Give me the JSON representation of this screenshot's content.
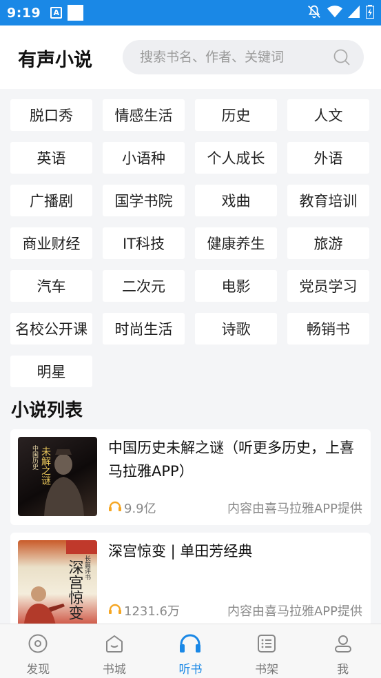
{
  "status_bar": {
    "time": "9:19",
    "a_glyph": "A"
  },
  "header": {
    "title": "有声小说",
    "search_placeholder": "搜索书名、作者、关键词"
  },
  "categories": [
    "脱口秀",
    "情感生活",
    "历史",
    "人文",
    "英语",
    "小语种",
    "个人成长",
    "外语",
    "广播剧",
    "国学书院",
    "戏曲",
    "教育培训",
    "商业财经",
    "IT科技",
    "健康养生",
    "旅游",
    "汽车",
    "二次元",
    "电影",
    "党员学习",
    "名校公开课",
    "时尚生活",
    "诗歌",
    "畅销书",
    "明星"
  ],
  "section_title": "小说列表",
  "novels": [
    {
      "title": "中国历史未解之谜（听更多历史，上喜马拉雅APP）",
      "plays": "9.9亿",
      "provider": "内容由喜马拉雅APP提供",
      "cover_text_a": "中国历史",
      "cover_text_b": "未解之谜"
    },
    {
      "title": "深宫惊变 | 单田芳经典",
      "plays": "1231.6万",
      "provider": "内容由喜马拉雅APP提供",
      "cover_text_a": "深宫惊变",
      "cover_text_b": "长篇评书"
    }
  ],
  "tabs": [
    {
      "label": "发现",
      "icon": "compass-icon",
      "active": false
    },
    {
      "label": "书城",
      "icon": "bookstore-icon",
      "active": false
    },
    {
      "label": "听书",
      "icon": "headphones-icon",
      "active": true
    },
    {
      "label": "书架",
      "icon": "list-icon",
      "active": false
    },
    {
      "label": "我",
      "icon": "user-icon",
      "active": false
    }
  ],
  "colors": {
    "accent": "#1a88e6",
    "play_icon": "#f5a623"
  }
}
